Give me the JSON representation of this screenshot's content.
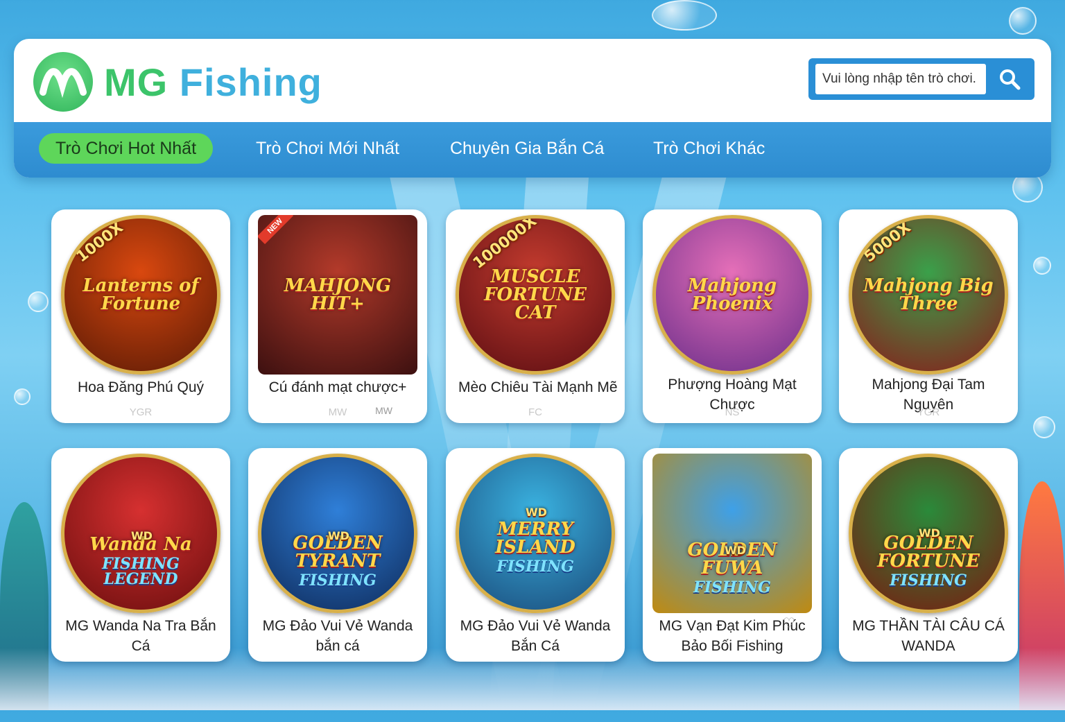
{
  "brand": {
    "name_part1": "MG",
    "name_part2": "Fishing",
    "logo_icon": "mg-logo-icon"
  },
  "search": {
    "placeholder": "Vui lòng nhập tên trò chơi.",
    "button_icon": "search-icon"
  },
  "nav": {
    "tabs": [
      {
        "label": "Trò Chơi Hot Nhất",
        "active": true
      },
      {
        "label": "Trò Chơi Mới Nhất",
        "active": false
      },
      {
        "label": "Chuyên Gia Bắn Cá",
        "active": false
      },
      {
        "label": "Trò Chơi Khác",
        "active": false
      }
    ]
  },
  "games": [
    {
      "name": "Hoa Đăng Phú Quý",
      "provider": "YGR",
      "art_title": "Lanterns of Fortune",
      "art_badge": "1000X",
      "colors": [
        "#d9480f",
        "#5a1a05"
      ]
    },
    {
      "name": "Cú đánh mạt chược+",
      "provider": "MW",
      "provider2": "MW",
      "art_title": "MAHJONG HIT+",
      "art_badge": "NEW",
      "colors": [
        "#b33a2a",
        "#3c1010"
      ]
    },
    {
      "name": "Mèo Chiêu Tài Mạnh Mẽ",
      "provider": "FC",
      "art_title": "MUSCLE FORTUNE CAT",
      "art_badge": "100000X",
      "colors": [
        "#c33b2e",
        "#5a0d12"
      ]
    },
    {
      "name": "Phượng Hoàng Mạt Chược",
      "provider": "NS",
      "art_title": "Mahjong Phoenix",
      "colors": [
        "#e56fb8",
        "#6a2e8a"
      ]
    },
    {
      "name": "Mahjong Đại Tam Nguyên",
      "provider": "YGR",
      "art_title": "Mahjong Big Three",
      "art_badge": "5000X",
      "colors": [
        "#3aa04a",
        "#8a1a1a"
      ]
    },
    {
      "name": "MG Wanda Na Tra Bắn Cá",
      "art_title": "Wanda Na",
      "art_sub": "FISHING LEGEND",
      "art_badge": "WD",
      "colors": [
        "#d63030",
        "#6a0e0e"
      ]
    },
    {
      "name": "MG Đảo Vui Vẻ Wanda bắn cá",
      "art_title": "GOLDEN TYRANT",
      "art_sub": "FISHING",
      "art_badge": "WD",
      "colors": [
        "#2f7fd8",
        "#0e2a5a"
      ]
    },
    {
      "name": "MG Đảo Vui Vẻ Wanda Bắn Cá",
      "art_title": "MERRY ISLAND",
      "art_sub": "FISHING",
      "art_badge": "WD",
      "colors": [
        "#3ab2e0",
        "#1a4a7a"
      ]
    },
    {
      "name": "MG Vạn Đạt Kim Phúc Bảo Bối Fishing",
      "art_title": "GOLDEN FUWA",
      "art_sub": "FISHING",
      "art_badge": "WD",
      "colors": [
        "#3ea0e8",
        "#c08a10"
      ]
    },
    {
      "name": "MG THẦN TÀI CÂU CÁ WANDA",
      "art_title": "GOLDEN FORTUNE",
      "art_sub": "FISHING",
      "art_badge": "WD",
      "colors": [
        "#2a8a3a",
        "#7a1a10"
      ]
    }
  ]
}
